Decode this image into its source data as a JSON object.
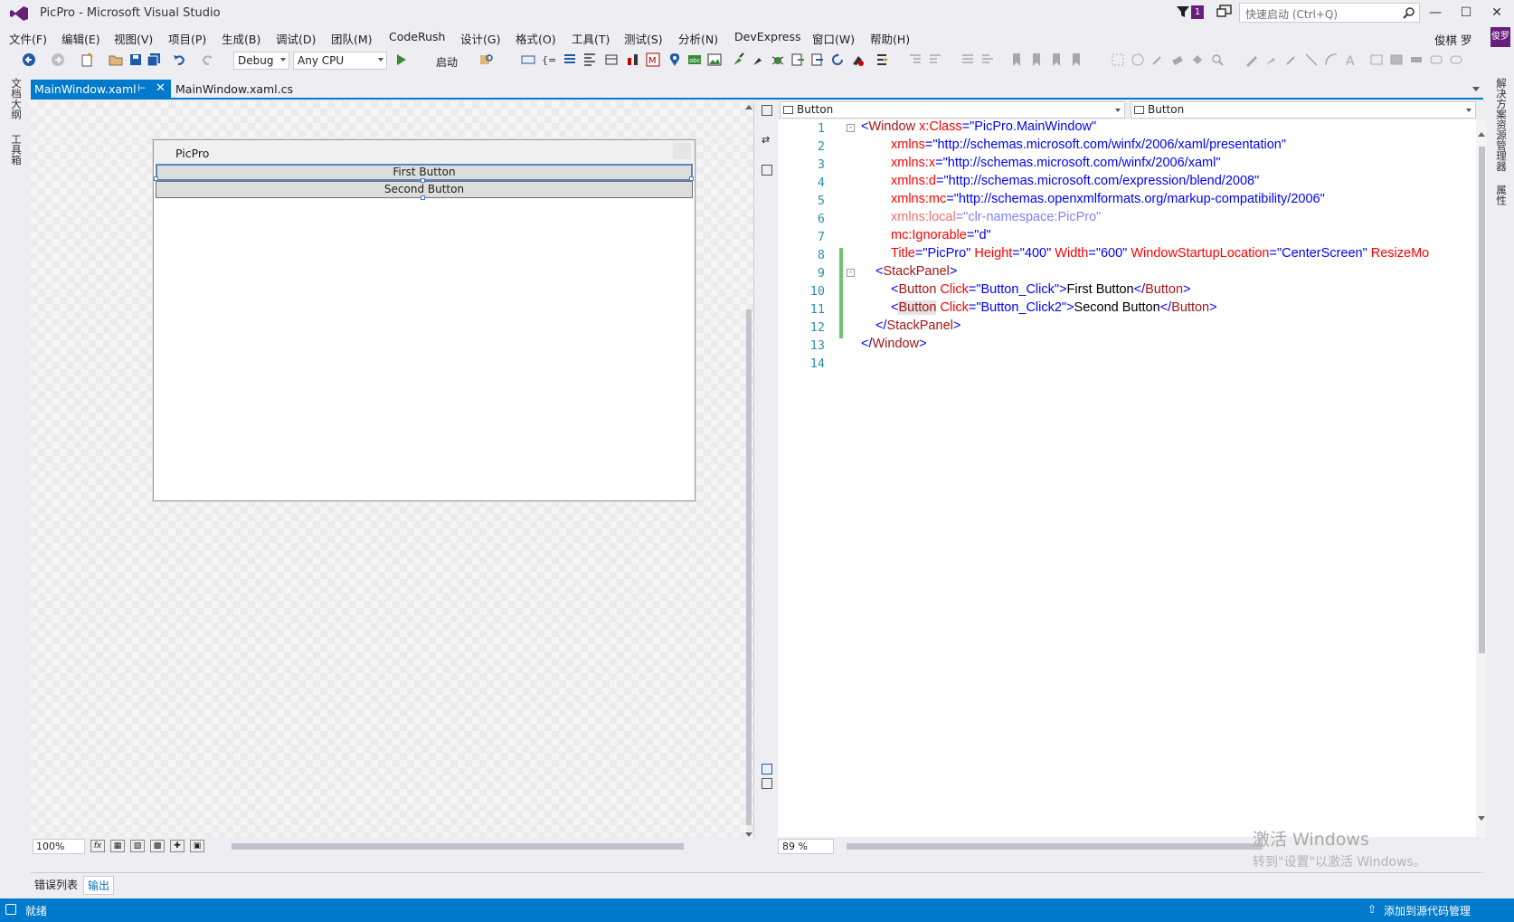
{
  "window": {
    "title": "PicPro - Microsoft Visual Studio",
    "notification_count": "1",
    "quick_launch_placeholder": "快速启动 (Ctrl+Q)",
    "user_name": "俊棋 罗",
    "user_avatar_text": "俊罗"
  },
  "menu": [
    "文件(F)",
    "编辑(E)",
    "视图(V)",
    "项目(P)",
    "生成(B)",
    "调试(D)",
    "团队(M)",
    "CodeRush",
    "设计(G)",
    "格式(O)",
    "工具(T)",
    "测试(S)",
    "分析(N)",
    "DevExpress",
    "窗口(W)",
    "帮助(H)"
  ],
  "toolbar": {
    "config": "Debug",
    "platform": "Any CPU",
    "run_label": "启动"
  },
  "left_rail": [
    "文档大纲",
    "工具箱"
  ],
  "right_rail": [
    "解决方案资源管理器",
    "属性"
  ],
  "tabs": {
    "active": "MainWindow.xaml",
    "other": "MainWindow.xaml.cs"
  },
  "designer": {
    "window_title": "PicPro",
    "button1": "First Button",
    "button2": "Second Button",
    "zoom": "100%"
  },
  "xaml": {
    "nav_left": "Button",
    "nav_right": "Button",
    "zoom": "89 %",
    "line_numbers": [
      "1",
      "2",
      "3",
      "4",
      "5",
      "6",
      "7",
      "8",
      "9",
      "10",
      "11",
      "12",
      "13",
      "14"
    ]
  },
  "watermark": {
    "line1": "激活 Windows",
    "line2": "转到\"设置\"以激活 Windows。"
  },
  "output_tabs": [
    "错误列表",
    "输出"
  ],
  "status": {
    "text": "就绪",
    "scm": "添加到源代码管理"
  },
  "colors": {
    "accent": "#007acc",
    "brand": "#68217a",
    "xaml_element": "#a31515",
    "xaml_attribute": "#ff0000",
    "xaml_value": "#0000ff",
    "line_number": "#2b91af"
  }
}
